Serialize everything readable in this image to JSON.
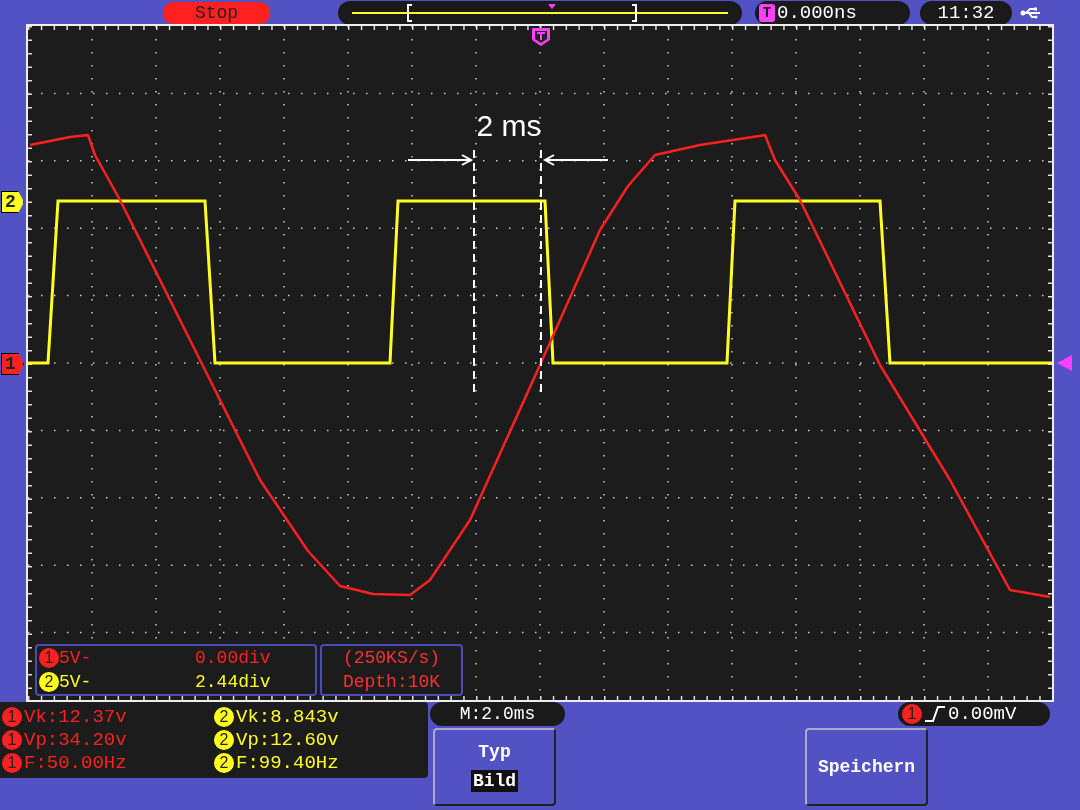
{
  "status": "Stop",
  "trigger_position": {
    "marker": "T",
    "time": "0.000ns"
  },
  "clock": "11:32",
  "channel_markers": [
    {
      "label": "2",
      "color": "#ffff20"
    },
    {
      "label": "1",
      "color": "#ff2020"
    }
  ],
  "annotation": "2 ms",
  "channel_info": [
    {
      "channel": "1",
      "color": "#ff2020",
      "scale": "5V-",
      "offset": "0.00div"
    },
    {
      "channel": "2",
      "color": "#ffff20",
      "scale": "5V-",
      "offset": "2.44div"
    }
  ],
  "acquisition": {
    "rate": "(250KS/s)",
    "depth": "Depth:10K"
  },
  "measurements": [
    {
      "color": "#ff2020",
      "items": [
        {
          "channel": "1",
          "text": "Vk:12.37v"
        },
        {
          "channel": "1",
          "text": "Vp:34.20v"
        },
        {
          "channel": "1",
          "text": "F:50.00Hz"
        }
      ]
    },
    {
      "color": "#ffff20",
      "items": [
        {
          "channel": "2",
          "text": "Vk:8.843v"
        },
        {
          "channel": "2",
          "text": "Vp:12.60v"
        },
        {
          "channel": "2",
          "text": "F:99.40Hz"
        }
      ]
    }
  ],
  "timebase": "M:2.0ms",
  "trigger": {
    "channel": "1",
    "color": "#ff2020",
    "value": "0.00mV"
  },
  "softkeys": [
    {
      "kind": "option",
      "title": "Typ",
      "value": "Bild"
    },
    {
      "kind": "action",
      "title": "Speichern"
    }
  ]
}
